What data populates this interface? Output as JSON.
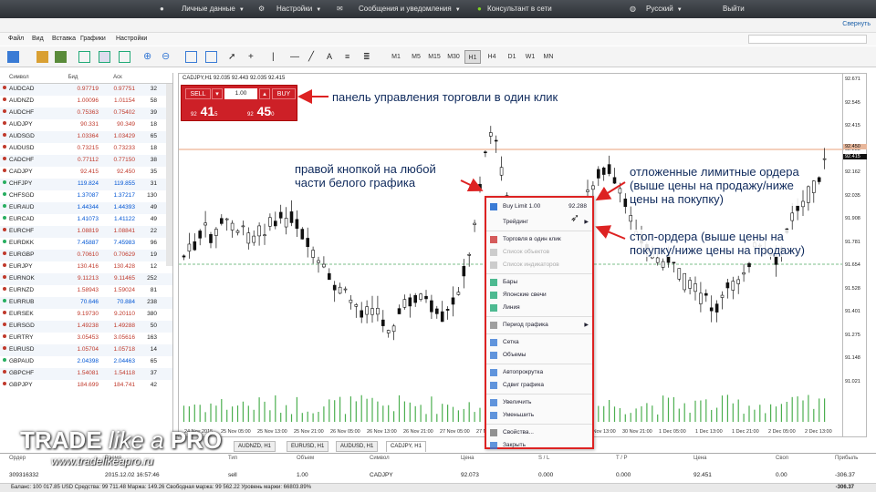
{
  "topbar": {
    "personal": "Личные данные",
    "settings": "Настройки",
    "messages": "Сообщения и уведомления",
    "consultant": "Консультант в сети",
    "language": "Русский",
    "logout": "Выйти"
  },
  "subbar": {
    "collapse": "Свернуть"
  },
  "menu": [
    "Файл",
    "Вид",
    "Вставка",
    "Графики",
    "Настройки"
  ],
  "timeframes": [
    "M1",
    "M5",
    "M15",
    "M30",
    "H1",
    "H4",
    "D1",
    "W1",
    "MN"
  ],
  "active_timeframe": "H1",
  "watchlist": {
    "headers": {
      "symbol": "Символ",
      "bid": "Бид",
      "ask": "Аск"
    },
    "rows": [
      {
        "s": "AUDCAD",
        "b": "0.97719",
        "a": "0.97751",
        "sp": "32",
        "c": "down"
      },
      {
        "s": "AUDNZD",
        "b": "1.00096",
        "a": "1.01154",
        "sp": "58",
        "c": "down"
      },
      {
        "s": "AUDCHF",
        "b": "0.75363",
        "a": "0.75402",
        "sp": "39",
        "c": "down"
      },
      {
        "s": "AUDJPY",
        "b": "90.331",
        "a": "90.349",
        "sp": "18",
        "c": "down"
      },
      {
        "s": "AUDSGD",
        "b": "1.03364",
        "a": "1.03429",
        "sp": "65",
        "c": "down"
      },
      {
        "s": "AUDUSD",
        "b": "0.73215",
        "a": "0.73233",
        "sp": "18",
        "c": "down"
      },
      {
        "s": "CADCHF",
        "b": "0.77112",
        "a": "0.77150",
        "sp": "38",
        "c": "down"
      },
      {
        "s": "CADJPY",
        "b": "92.415",
        "a": "92.450",
        "sp": "35",
        "c": "down"
      },
      {
        "s": "CHFJPY",
        "b": "119.824",
        "a": "119.855",
        "sp": "31",
        "c": "up"
      },
      {
        "s": "CHFSGD",
        "b": "1.37087",
        "a": "1.37217",
        "sp": "130",
        "c": "up"
      },
      {
        "s": "EURAUD",
        "b": "1.44344",
        "a": "1.44393",
        "sp": "49",
        "c": "up"
      },
      {
        "s": "EURCAD",
        "b": "1.41073",
        "a": "1.41122",
        "sp": "49",
        "c": "up"
      },
      {
        "s": "EURCHF",
        "b": "1.08819",
        "a": "1.08841",
        "sp": "22",
        "c": "down"
      },
      {
        "s": "EURDKK",
        "b": "7.45887",
        "a": "7.45983",
        "sp": "96",
        "c": "up"
      },
      {
        "s": "EURGBP",
        "b": "0.70610",
        "a": "0.70629",
        "sp": "19",
        "c": "down"
      },
      {
        "s": "EURJPY",
        "b": "130.416",
        "a": "130.428",
        "sp": "12",
        "c": "down"
      },
      {
        "s": "EURNOK",
        "b": "9.11213",
        "a": "9.11465",
        "sp": "252",
        "c": "down"
      },
      {
        "s": "EURNZD",
        "b": "1.58943",
        "a": "1.59024",
        "sp": "81",
        "c": "down"
      },
      {
        "s": "EURRUB",
        "b": "70.646",
        "a": "70.884",
        "sp": "238",
        "c": "up"
      },
      {
        "s": "EURSEK",
        "b": "9.19730",
        "a": "9.20110",
        "sp": "380",
        "c": "down"
      },
      {
        "s": "EURSGD",
        "b": "1.49238",
        "a": "1.49288",
        "sp": "50",
        "c": "down"
      },
      {
        "s": "EURTRY",
        "b": "3.05453",
        "a": "3.05616",
        "sp": "163",
        "c": "down"
      },
      {
        "s": "EURUSD",
        "b": "1.05704",
        "a": "1.05718",
        "sp": "14",
        "c": "down"
      },
      {
        "s": "GBPAUD",
        "b": "2.04398",
        "a": "2.04463",
        "sp": "65",
        "c": "up"
      },
      {
        "s": "GBPCHF",
        "b": "1.54081",
        "a": "1.54118",
        "sp": "37",
        "c": "down"
      },
      {
        "s": "GBPJPY",
        "b": "184.699",
        "a": "184.741",
        "sp": "42",
        "c": "down"
      }
    ]
  },
  "chart": {
    "title": "CADJPY,H1  92.035 92.443 92.035 92.415",
    "price_labels": [
      "92.671",
      "92.545",
      "92.415",
      "92.288",
      "92.162",
      "92.035",
      "91.908",
      "91.781",
      "91.654",
      "91.528",
      "91.401",
      "91.275",
      "91.148",
      "91.021"
    ],
    "bid_label": "92.415",
    "ask_label": "92.450",
    "time_labels": [
      "24 Nov 2015",
      "25 Nov 05:00",
      "25 Nov 13:00",
      "25 Nov 21:00",
      "26 Nov 05:00",
      "26 Nov 13:00",
      "26 Nov 21:00",
      "27 Nov 05:00",
      "27 Nov 13:00",
      "27 Nov 21:00",
      "30 Nov 05:00",
      "30 Nov 13:00",
      "30 Nov 21:00",
      "1 Dec 05:00",
      "1 Dec 13:00",
      "1 Dec 21:00",
      "2 Dec 05:00",
      "2 Dec 13:00"
    ]
  },
  "one_click": {
    "sell": "SELL",
    "buy": "BUY",
    "volume": "1.00",
    "sell_small": "92",
    "sell_big": "41",
    "sell_sup": "5",
    "buy_small": "92",
    "buy_big": "45",
    "buy_sup": "0"
  },
  "annotations": {
    "panel": "панель управления торговли в один клик",
    "right_click": "правой кнопкой на любой\nчасти белого графика",
    "limit": "отложенные лимитные ордера\n(выше цены на продажу/ниже\nцены на покупку)",
    "stop": "стоп-ордера (выше цены на\nпокупку/ниже цены на продажу)"
  },
  "context_menu": {
    "buy_limit": "Buy Limit 1.00",
    "buy_limit_price": "92.288",
    "trading": "Трейдинг",
    "items": [
      {
        "label": "Торговля в один клик",
        "dis": false
      },
      {
        "label": "Список объектов",
        "dis": true
      },
      {
        "label": "Список индикаторов",
        "dis": true
      },
      {
        "sep": true
      },
      {
        "label": "Бары",
        "dis": false
      },
      {
        "label": "Японские свечи",
        "dis": false
      },
      {
        "label": "Линия",
        "dis": false
      },
      {
        "sep": true
      },
      {
        "label": "Период графика",
        "dis": false,
        "sub": true
      },
      {
        "sep": true
      },
      {
        "label": "Сетка",
        "dis": false
      },
      {
        "label": "Объемы",
        "dis": false
      },
      {
        "sep": true
      },
      {
        "label": "Автопрокрутка",
        "dis": false
      },
      {
        "label": "Сдвиг графика",
        "dis": false
      },
      {
        "sep": true
      },
      {
        "label": "Увеличить",
        "dis": false
      },
      {
        "label": "Уменьшить",
        "dis": false
      },
      {
        "sep": true
      },
      {
        "label": "Свойства...",
        "dis": false
      },
      {
        "label": "Закрыть",
        "dis": false
      }
    ]
  },
  "tabs": [
    "AUDNZD, H1",
    "EURUSD, H1",
    "AUDUSD, H1",
    "CADJPY, H1"
  ],
  "active_tab": "CADJPY, H1",
  "positions": {
    "headers": [
      "Ордер",
      "Время",
      "Тип",
      "Объем",
      "Символ",
      "Цена",
      "S / L",
      "T / P",
      "Цена",
      "Своп",
      "Прибыль"
    ],
    "row": [
      "309316332",
      "2015.12.02 16:57:46",
      "sell",
      "1.00",
      "CADJPY",
      "92.073",
      "0.000",
      "0.000",
      "92.451",
      "0.00",
      "-306.37"
    ]
  },
  "status": {
    "text": "Баланс: 100 017.85 USD  Средства: 99 711.48  Маржа: 149.26  Свободная маржа: 99 562.22  Уровень маржи: 66803.89%",
    "total": "-306.37"
  },
  "watermark": {
    "brand_a": "TRADE",
    "brand_b": "like a",
    "brand_c": "PRO",
    "url": "www.tradelikeapro.ru"
  },
  "colors": {
    "sell": "#cd2027",
    "annotation": "#0f2a5c",
    "candle": "#111111"
  }
}
